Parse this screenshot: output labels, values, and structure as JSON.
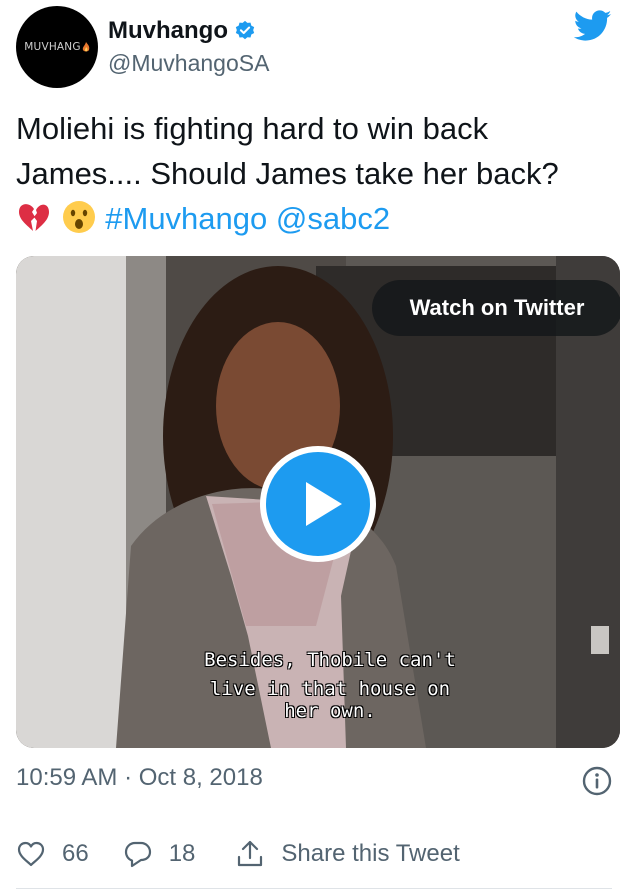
{
  "author": {
    "display_name": "Muvhango",
    "handle": "@MuvhangoSA",
    "avatar_text": "MUVHANG",
    "verified": true
  },
  "tweet": {
    "text_main": "Moliehi is fighting hard to win back James.... Should James take her back?",
    "emojis": [
      "broken-heart-emoji",
      "surprised-face-emoji"
    ],
    "hashtag": "#Muvhango",
    "mention": "@sabc2"
  },
  "media": {
    "watch_label": "Watch on Twitter",
    "subtitle_line1": "Besides, Thobile can't",
    "subtitle_line2": "live in that house on her own."
  },
  "meta": {
    "timestamp": "10:59 AM · Oct 8, 2018"
  },
  "actions": {
    "like_count": "66",
    "reply_count": "18",
    "share_label": "Share this Tweet"
  },
  "colors": {
    "accent": "#1d9bf0",
    "secondary_text": "#536471"
  }
}
